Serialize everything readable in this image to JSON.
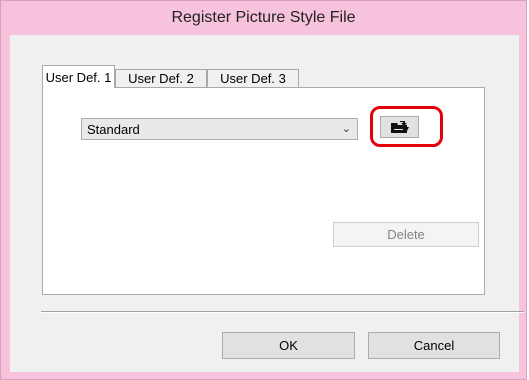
{
  "window": {
    "title": "Register Picture Style File"
  },
  "tabs": [
    {
      "label": "User Def. 1",
      "active": true
    },
    {
      "label": "User Def. 2",
      "active": false
    },
    {
      "label": "User Def. 3",
      "active": false
    }
  ],
  "style_select": {
    "selected": "Standard"
  },
  "load_button": {
    "icon": "open-file-icon"
  },
  "delete_label": "Delete",
  "ok_label": "OK",
  "cancel_label": "Cancel",
  "colors": {
    "frame": "#f7c2dc",
    "highlight": "#e3000b",
    "client": "#f0f0f0"
  }
}
